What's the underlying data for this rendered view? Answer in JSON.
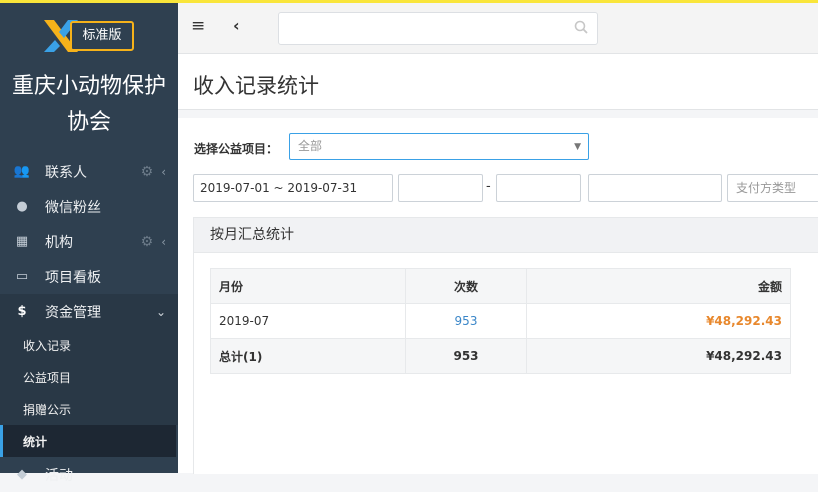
{
  "sidebar": {
    "logo_badge": "标准版",
    "org_name_line1": "重庆小动物保护",
    "org_name_line2": "协会",
    "menu": [
      {
        "label": "联系人",
        "icon": "users-icon"
      },
      {
        "label": "微信粉丝",
        "icon": "chat-bubble-icon"
      },
      {
        "label": "机构",
        "icon": "building-icon"
      },
      {
        "label": "项目看板",
        "icon": "inbox-icon"
      },
      {
        "label": "资金管理",
        "icon": "dollar-icon"
      }
    ],
    "submenu": [
      {
        "label": "收入记录"
      },
      {
        "label": "公益项目"
      },
      {
        "label": "捐赠公示"
      },
      {
        "label": "统计"
      }
    ],
    "partial_next": "活动"
  },
  "page": {
    "title": "收入记录统计"
  },
  "filters": {
    "project_label": "选择公益项目：",
    "project_value": "全部",
    "date_range": "2019-07-01 ~ 2019-07-31",
    "payment_type_placeholder": "支付方类型"
  },
  "panel": {
    "title": "按月汇总统计"
  },
  "table": {
    "headers": {
      "month": "月份",
      "count": "次数",
      "amount": "金额"
    },
    "rows": [
      {
        "month": "2019-07",
        "count": "953",
        "amount": "¥48,292.43"
      }
    ],
    "total": {
      "label": "总计(1)",
      "count": "953",
      "amount": "¥48,292.43"
    }
  },
  "colors": {
    "sidebar": "#2f4050",
    "accent": "#3aa1e6",
    "highlight_amount": "#e8882d",
    "logo_yellow": "#f6b21a",
    "top_line": "#f9e53a"
  }
}
